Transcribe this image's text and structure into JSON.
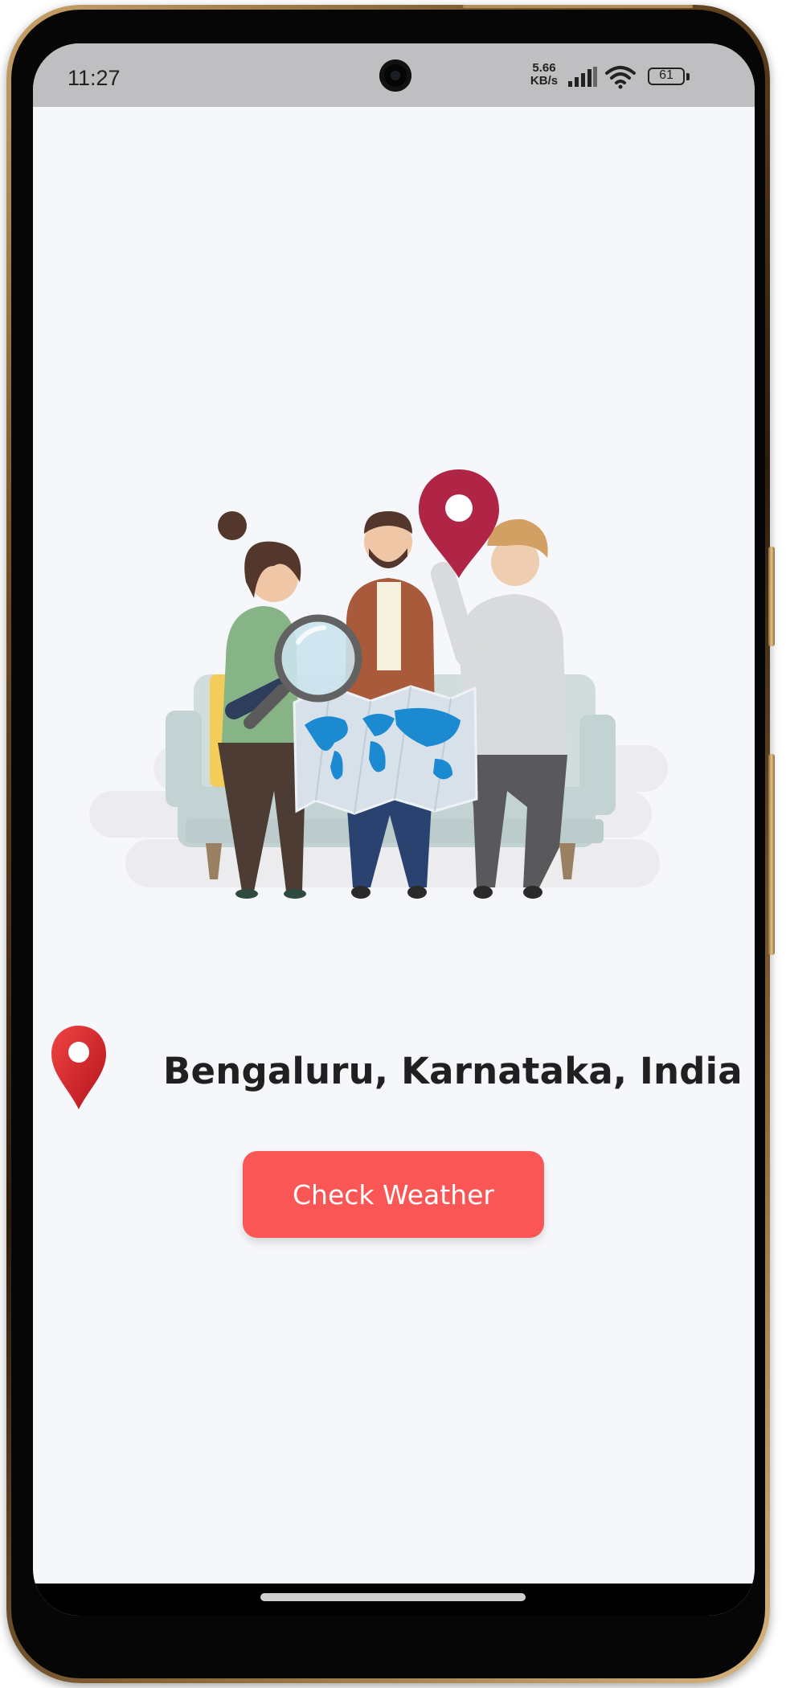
{
  "status_bar": {
    "time": "11:27",
    "net_speed_value": "5.66",
    "net_speed_unit": "KB/s",
    "battery": "61",
    "icons": [
      "signal-icon",
      "wifi-icon",
      "battery-icon"
    ]
  },
  "illustration": {
    "icon": "travel-map-illustration"
  },
  "location": {
    "icon": "location-pin-icon",
    "text": "Bengaluru, Karnataka, India"
  },
  "actions": {
    "check_weather_label": "Check Weather"
  },
  "colors": {
    "accent": "#fb5656",
    "background": "#f6f7fb",
    "pin_red": "#e02d2f"
  }
}
